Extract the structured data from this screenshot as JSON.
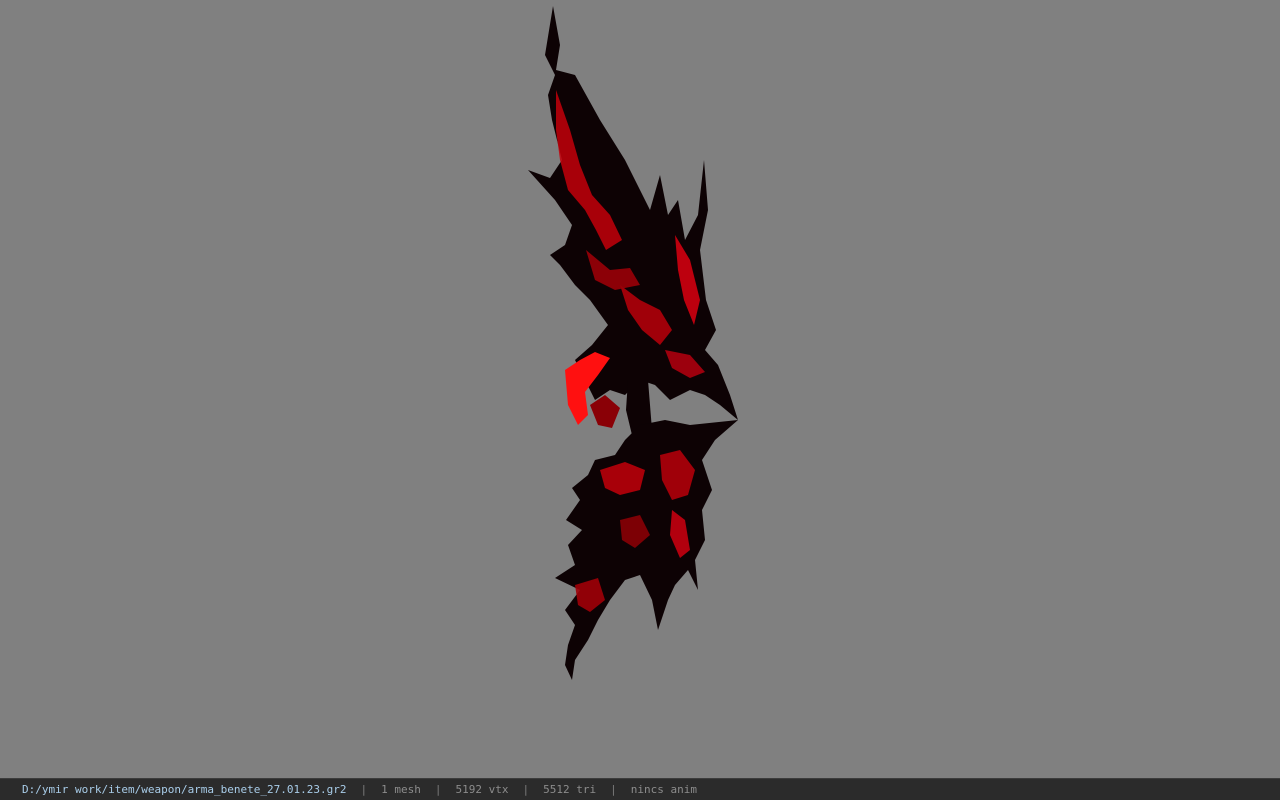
{
  "viewport": {
    "background": "#808080",
    "model_name": "arma_benete",
    "model_colors": {
      "dark": "#0d0204",
      "red": "#c4000a",
      "bright_red": "#ff1010"
    }
  },
  "statusbar": {
    "path": "D:/ymir work/item/weapon/arma_benete_27.01.23.gr2",
    "sep": "|",
    "mesh": "1 mesh",
    "vtx": "5192 vtx",
    "tri": "5512 tri",
    "anim": "nincs anim"
  }
}
